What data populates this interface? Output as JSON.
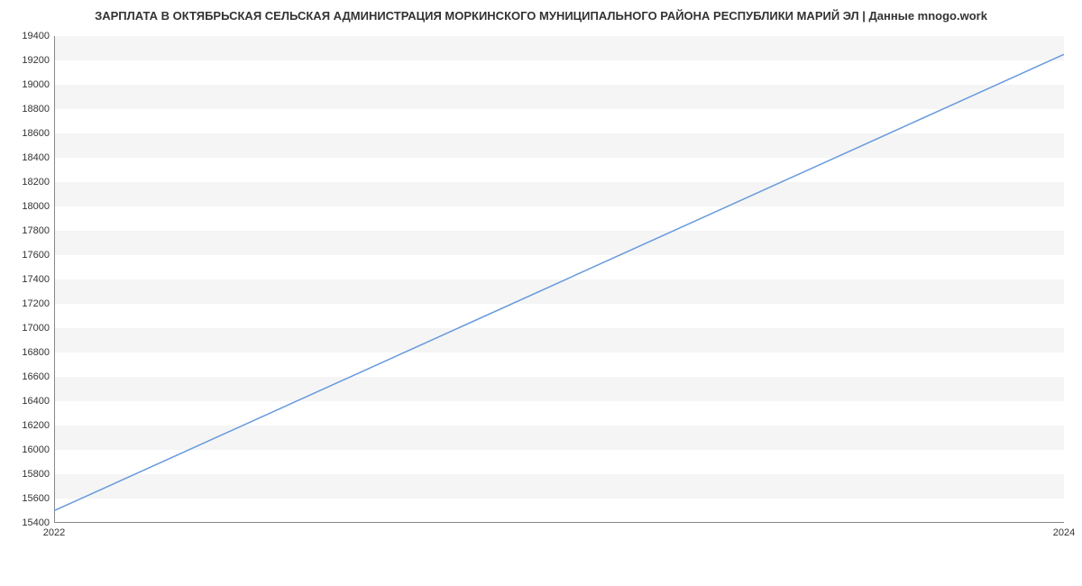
{
  "chart_data": {
    "type": "line",
    "title": "ЗАРПЛАТА В ОКТЯБРЬСКАЯ СЕЛЬСКАЯ АДМИНИСТРАЦИЯ МОРКИНСКОГО МУНИЦИПАЛЬНОГО РАЙОНА РЕСПУБЛИКИ МАРИЙ ЭЛ | Данные mnogo.work",
    "x": [
      2022,
      2024
    ],
    "values": [
      15500,
      19250
    ],
    "xlabel": "",
    "ylabel": "",
    "x_ticks": [
      2022,
      2024
    ],
    "y_ticks": [
      15400,
      15600,
      15800,
      16000,
      16200,
      16400,
      16600,
      16800,
      17000,
      17200,
      17400,
      17600,
      17800,
      18000,
      18200,
      18400,
      18600,
      18800,
      19000,
      19200,
      19400
    ],
    "xlim": [
      2022,
      2024
    ],
    "ylim": [
      15400,
      19400
    ],
    "line_color": "#6699dd"
  }
}
